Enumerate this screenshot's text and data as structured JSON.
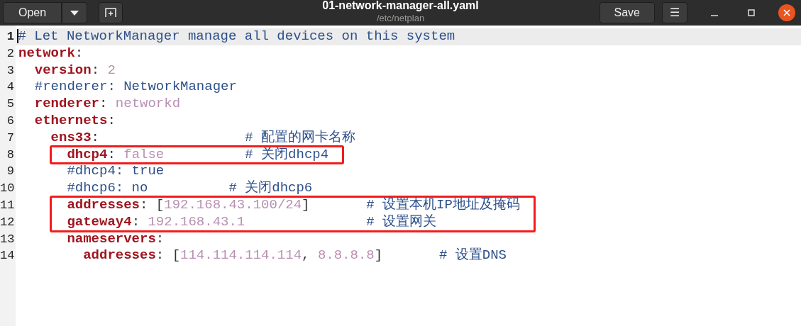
{
  "header": {
    "open_label": "Open",
    "title": "01-network-manager-all.yaml",
    "subtitle": "/etc/netplan",
    "save_label": "Save",
    "menu_glyph": "☰"
  },
  "lines": [
    {
      "number": "1",
      "current": true,
      "highlighted": false,
      "tokens": [
        {
          "kind": "comment",
          "text": "# Let NetworkManager manage all devices on this system"
        }
      ]
    },
    {
      "number": "2",
      "current": false,
      "highlighted": false,
      "tokens": [
        {
          "kind": "key",
          "text": "network"
        },
        {
          "kind": "punct",
          "text": ":"
        }
      ],
      "children": [
        {
          "number": "3",
          "current": false,
          "highlighted": false,
          "tokens": [
            {
              "kind": "key",
              "text": "version"
            },
            {
              "kind": "punct",
              "text": ":"
            },
            {
              "kind": "value",
              "text": " 2"
            }
          ]
        },
        {
          "number": "4",
          "current": false,
          "highlighted": false,
          "tokens": [
            {
              "kind": "comment",
              "text": "#renderer: NetworkManager"
            }
          ]
        },
        {
          "number": "5",
          "current": false,
          "highlighted": false,
          "tokens": [
            {
              "kind": "key",
              "text": "renderer"
            },
            {
              "kind": "punct",
              "text": ":"
            },
            {
              "kind": "value",
              "text": " networkd"
            }
          ]
        },
        {
          "number": "6",
          "current": false,
          "highlighted": false,
          "tokens": [
            {
              "kind": "key",
              "text": "ethernets"
            },
            {
              "kind": "punct",
              "text": ":"
            }
          ],
          "children": [
            {
              "number": "7",
              "current": false,
              "highlighted": false,
              "tokens": [
                {
                  "kind": "key",
                  "text": "ens33"
                },
                {
                  "kind": "punct",
                  "text": ":"
                },
                {
                  "kind": "comment",
                  "text": "                  # 配置的网卡名称"
                }
              ],
              "children": [
                {
                  "number": "8",
                  "current": false,
                  "highlighted": true,
                  "tokens": [
                    {
                      "kind": "key",
                      "text": "dhcp4"
                    },
                    {
                      "kind": "punct",
                      "text": ":"
                    },
                    {
                      "kind": "value",
                      "text": " false"
                    },
                    {
                      "kind": "comment",
                      "text": "          # 关闭dhcp4"
                    }
                  ]
                },
                {
                  "number": "9",
                  "current": false,
                  "highlighted": false,
                  "tokens": [
                    {
                      "kind": "comment",
                      "text": "#dhcp4: true"
                    }
                  ]
                },
                {
                  "number": "10",
                  "current": false,
                  "highlighted": false,
                  "tokens": [
                    {
                      "kind": "comment",
                      "text": "#dhcp6: no          # 关闭dhcp6"
                    }
                  ]
                },
                {
                  "number": "11",
                  "current": false,
                  "highlighted": true,
                  "tokens": [
                    {
                      "kind": "key",
                      "text": "addresses"
                    },
                    {
                      "kind": "punct",
                      "text": ": ["
                    },
                    {
                      "kind": "value",
                      "text": "192.168.43.100/24"
                    },
                    {
                      "kind": "punct",
                      "text": "]"
                    },
                    {
                      "kind": "comment",
                      "text": "       # 设置本机IP地址及掩码"
                    }
                  ]
                },
                {
                  "number": "12",
                  "current": false,
                  "highlighted": true,
                  "tokens": [
                    {
                      "kind": "key",
                      "text": "gateway4"
                    },
                    {
                      "kind": "punct",
                      "text": ":"
                    },
                    {
                      "kind": "value",
                      "text": " 192.168.43.1"
                    },
                    {
                      "kind": "comment",
                      "text": "               # 设置网关"
                    }
                  ]
                },
                {
                  "number": "13",
                  "current": false,
                  "highlighted": false,
                  "tokens": [
                    {
                      "kind": "key",
                      "text": "nameservers"
                    },
                    {
                      "kind": "punct",
                      "text": ":"
                    }
                  ],
                  "children": [
                    {
                      "number": "14",
                      "current": false,
                      "highlighted": false,
                      "tokens": [
                        {
                          "kind": "key",
                          "text": "addresses"
                        },
                        {
                          "kind": "punct",
                          "text": ": ["
                        },
                        {
                          "kind": "value",
                          "text": "114.114.114.114"
                        },
                        {
                          "kind": "punct",
                          "text": ", "
                        },
                        {
                          "kind": "value",
                          "text": "8.8.8.8"
                        },
                        {
                          "kind": "punct",
                          "text": "]"
                        },
                        {
                          "kind": "comment",
                          "text": "       # 设置DNS"
                        }
                      ]
                    }
                  ]
                }
              ]
            }
          ]
        }
      ]
    }
  ]
}
